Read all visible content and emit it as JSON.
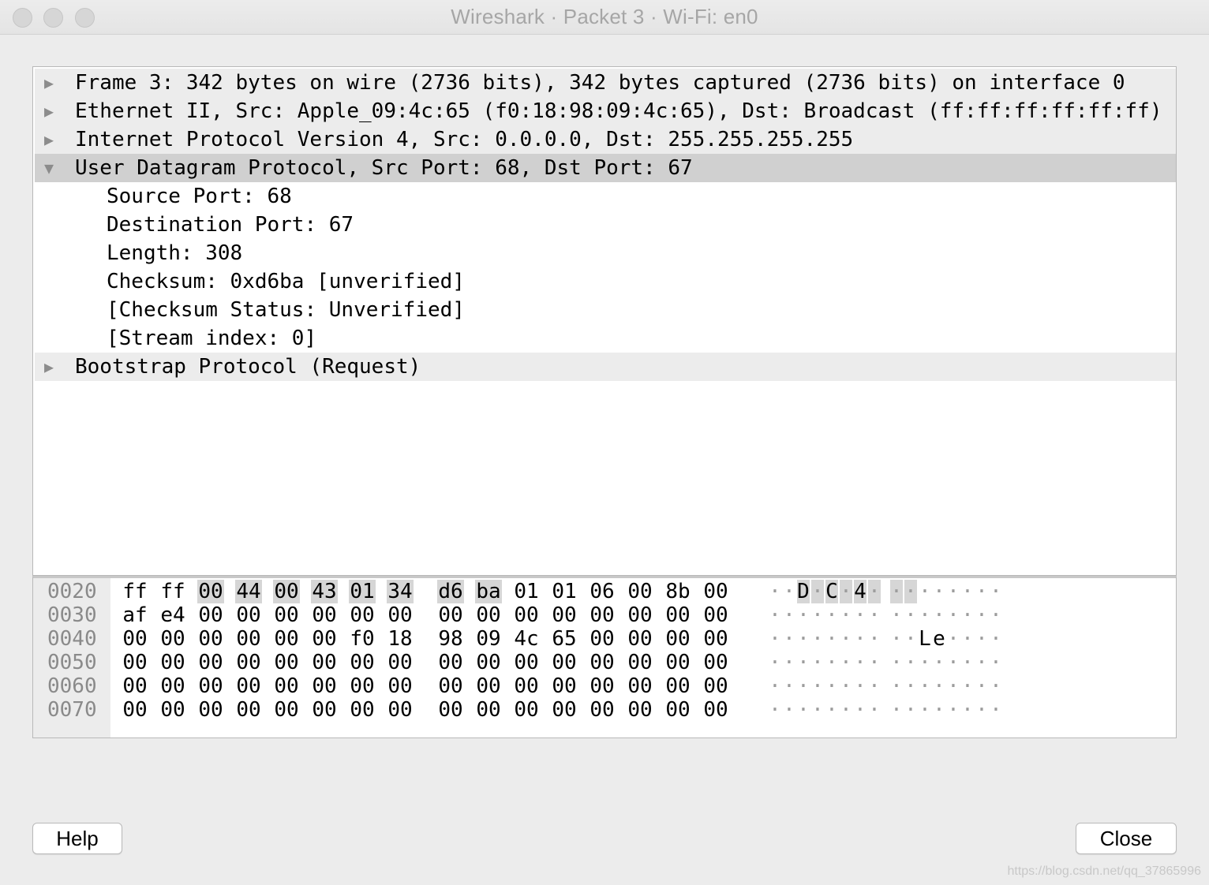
{
  "window": {
    "title": "Wireshark · Packet 3 · Wi-Fi: en0"
  },
  "tree": {
    "rows": [
      {
        "text": "Frame 3: 342 bytes on wire (2736 bits), 342 bytes captured (2736 bits) on interface 0",
        "expanded": false
      },
      {
        "text": "Ethernet II, Src: Apple_09:4c:65 (f0:18:98:09:4c:65), Dst: Broadcast (ff:ff:ff:ff:ff:ff)",
        "expanded": false
      },
      {
        "text": "Internet Protocol Version 4, Src: 0.0.0.0, Dst: 255.255.255.255",
        "expanded": false
      },
      {
        "text": "User Datagram Protocol, Src Port: 68, Dst Port: 67",
        "expanded": true
      },
      {
        "text": "Source Port: 68"
      },
      {
        "text": "Destination Port: 67"
      },
      {
        "text": "Length: 308"
      },
      {
        "text": "Checksum: 0xd6ba [unverified]"
      },
      {
        "text": "[Checksum Status: Unverified]"
      },
      {
        "text": "[Stream index: 0]"
      },
      {
        "text": "Bootstrap Protocol (Request)",
        "expanded": false
      }
    ]
  },
  "hex_dump": {
    "rows": [
      {
        "offset": "0020",
        "bytes": [
          "ff",
          "ff",
          "00",
          "44",
          "00",
          "43",
          "01",
          "34",
          "d6",
          "ba",
          "01",
          "01",
          "06",
          "00",
          "8b",
          "00"
        ],
        "ascii": "··D·C·4·········"
      },
      {
        "offset": "0030",
        "bytes": [
          "af",
          "e4",
          "00",
          "00",
          "00",
          "00",
          "00",
          "00",
          "00",
          "00",
          "00",
          "00",
          "00",
          "00",
          "00",
          "00"
        ],
        "ascii": "················"
      },
      {
        "offset": "0040",
        "bytes": [
          "00",
          "00",
          "00",
          "00",
          "00",
          "00",
          "f0",
          "18",
          "98",
          "09",
          "4c",
          "65",
          "00",
          "00",
          "00",
          "00"
        ],
        "ascii": "··········Le····"
      },
      {
        "offset": "0050",
        "bytes": [
          "00",
          "00",
          "00",
          "00",
          "00",
          "00",
          "00",
          "00",
          "00",
          "00",
          "00",
          "00",
          "00",
          "00",
          "00",
          "00"
        ],
        "ascii": "················"
      },
      {
        "offset": "0060",
        "bytes": [
          "00",
          "00",
          "00",
          "00",
          "00",
          "00",
          "00",
          "00",
          "00",
          "00",
          "00",
          "00",
          "00",
          "00",
          "00",
          "00"
        ],
        "ascii": "················"
      },
      {
        "offset": "0070",
        "bytes": [
          "00",
          "00",
          "00",
          "00",
          "00",
          "00",
          "00",
          "00",
          "00",
          "00",
          "00",
          "00",
          "00",
          "00",
          "00",
          "00"
        ],
        "ascii": "················"
      }
    ]
  },
  "buttons": {
    "help_label": "Help",
    "close_label": "Close"
  },
  "watermark": "https://blog.csdn.net/qq_37865996",
  "colors": {
    "selected_row": "#d0d0d0",
    "highlight_bytes": "#d6d6d6"
  }
}
